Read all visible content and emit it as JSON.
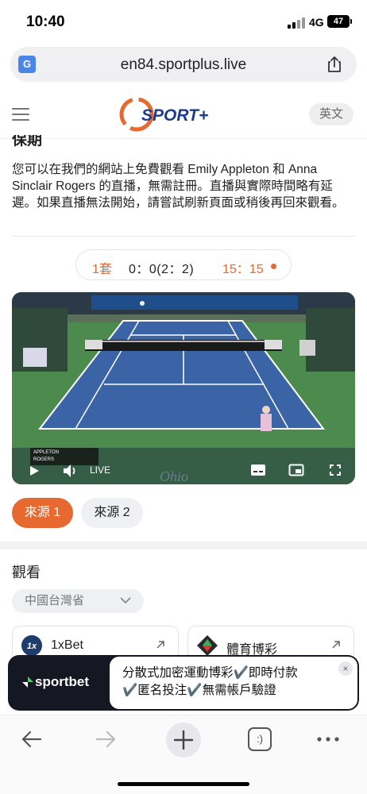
{
  "status_bar": {
    "time": "10:40",
    "network": "4G",
    "battery": "47"
  },
  "browser": {
    "url": "en84.sportplus.live",
    "translate_icon": "translate-icon",
    "share_icon": "share-icon"
  },
  "site_header": {
    "logo_text": "SPORT+",
    "language_label": "英文"
  },
  "article": {
    "heading": "保期",
    "intro": "您可以在我們的網站上免費觀看 Emily Appleton 和 Anna Sinclair Rogers 的直播，無需註冊。直播與實際時間略有延遲。如果直播無法開始，請嘗試刷新頁面或稍後再回來觀看。"
  },
  "score": {
    "set_label": "1套",
    "score_text": "0：0(2：2)",
    "points_text": "15：15"
  },
  "video": {
    "live_label": "LIVE",
    "scorebug_player1": "APPLETON",
    "scorebug_player2": "ROGERS",
    "billboard_text": "Ohio"
  },
  "sources": [
    "來源 1",
    "來源 2"
  ],
  "watch": {
    "title": "觀看",
    "region": "中國台灣省",
    "bookmakers": [
      {
        "name": "1xBet",
        "logo": "1x"
      },
      {
        "name": "體育博彩"
      }
    ]
  },
  "ad": {
    "brand": "sportbet",
    "line1": "分散式加密運動博彩✔️即時付款",
    "line2": "✔️匿名投注✔️無需帳戶驗證",
    "close": "×"
  },
  "toolbar": {
    "tabs_label": ":)"
  },
  "colors": {
    "accent": "#e8692f",
    "dark_ad": "#151722",
    "court_blue": "#3a64a6"
  }
}
